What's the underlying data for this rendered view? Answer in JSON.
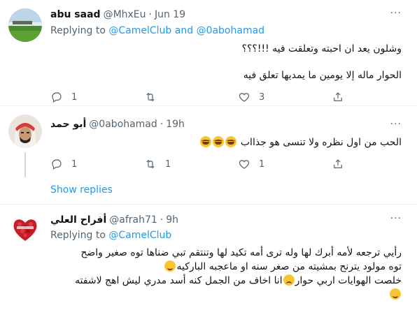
{
  "tweets": [
    {
      "name": "abu saad",
      "handle": "@MhxEu",
      "dot": "·",
      "time": "Jun 19",
      "more": "···",
      "reply_prefix": "Replying to",
      "mention1": "@CamelClub",
      "reply_and": "and",
      "mention2": "@0abohamad",
      "lines": [
        "وشلون يعد ان احبته وتعلقت فيه !!!؟؟؟",
        "الحوار ماله إلا يومين ما يمديها تعلق فيه"
      ],
      "actions": {
        "reply": "1",
        "retweet": "",
        "like": "3",
        "share": ""
      }
    },
    {
      "name": "أبو حمد",
      "handle": "@0abohamad",
      "dot": "·",
      "time": "19h",
      "more": "···",
      "lines": [
        "الحب من اول نظره ولا تنسى هو جذااب"
      ],
      "actions": {
        "reply": "1",
        "retweet": "1",
        "like": "1",
        "share": ""
      }
    },
    {
      "name": "أفراح العلي",
      "handle": "@afrah71",
      "dot": "·",
      "time": "9h",
      "more": "···",
      "reply_prefix": "Replying to",
      "mention1": "@CamelClub",
      "lines": [
        "رأيي ترجعه لأمه أبرك لها وله ترى أمه تكيد لها وتنتقم تبي ضناها توه صغير واضح",
        "توه مولود يترنح بمشيته من صغر سنه او ماعجبه الباركيه",
        "خلصت الهوايات اربي حوار",
        "انا اخاف من الجمل كنه أسد مدري  ليش اهج لاشفته"
      ]
    }
  ],
  "show_replies": "Show replies",
  "colors": {
    "accent": "#1d9bf0",
    "muted": "#536471",
    "divider": "#eff3f4"
  }
}
